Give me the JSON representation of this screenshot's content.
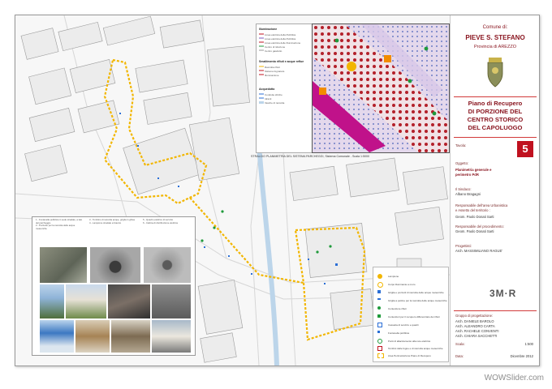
{
  "title_block": {
    "comune_label": "Comune di:",
    "comune_name": "PIEVE S. STEFANO",
    "province": "Provincia di AREZZO",
    "plan_title_lines": [
      "Piano di Recupero",
      "DI PORZIONE DEL",
      "CENTRO STORICO",
      "DEL CAPOLUOGO"
    ],
    "tavola_label": "Tavola:",
    "tavola_number": "5",
    "oggetto_label": "Oggetto:",
    "oggetto_lines": [
      "Planimetria generale e",
      "perimetro PdR"
    ],
    "sindaco_label": "Il Sindaco:",
    "sindaco_name": "Albano Bragagni",
    "resp_label_lines": [
      "Responsabile dell'area Urbanistica",
      "e Assetto del territorio :"
    ],
    "resp_name": "Geom. Paolo Donati Sarti",
    "resp_proc_label": "Responsabile del procedimento:",
    "resp_proc_name": "Geom. Paolo Donati Sarti",
    "progettisti_label": "Progettisti:",
    "progettisti_name": "Arch. MASSIMILIANO RAGUE'",
    "logo_text": "3M·R",
    "gruppo_label": "Gruppo di progettazione:",
    "gruppo_names": [
      "Arch. DANIELE BAROLO",
      "Arch. ALEANDRO CARTA",
      "Arch. RACHELE CONVENTI",
      "Arch. CHIARA SACCHETTI"
    ],
    "scala_label": "Scala:",
    "scala_value": "1:500",
    "data_label": "Data:",
    "data_value": "Dicembre 2012"
  },
  "map": {
    "inset_caption": "STRALCIO PLANIMETRIA DEL SISTEMA PARCHEGGI, Sistema Comunale - Scala 1:5000",
    "top_legend": {
      "heading_1": "Illuminazione",
      "items_1": [
        "Linea elettrica della Pubblica",
        "Linea elettrica della Pubblica",
        "Linea elettrica delle Illuminazione",
        "Centro di riduzione",
        "Centro gasdotto"
      ],
      "heading_2": "Smaltimento rifiuti e acque reflue",
      "items_2": [
        "Raccolta rifiuti",
        "Sistema fognatura",
        "Illuminazione"
      ],
      "heading_3": "Acquedotto",
      "items_3": [
        "Condotte idriche",
        "Idranti",
        "Vasche di raccolta"
      ]
    },
    "bottom_legend": {
      "items": [
        "Lampione",
        "Corpo illuminante a muro",
        "Griglia e pozzetti di raccolta delle acque meteoriche",
        "Griglia a pettine per la raccolta delle acque meteoriche",
        "Contenitore rifiuti",
        "Contenitori per il recupero differenziato dei rifiuti",
        "Cassetta di servizio e quadri",
        "Fontanella pubblica",
        "Punti di allacciamento alla rete elettrica",
        "Tombini delle fogne e di raccolta acque meteoriche",
        "Area Perimetrazione Piano di Recupero"
      ]
    },
    "photo_notes": [
      "1 - Fontanella pubblica in sede stradale, a lato del parcheggio",
      "2 - Pozzetto per la raccolta delle acque meteoriche",
      "3 - Tombino di raccolta acque, griglia in ghisa",
      "4 - Lampione stradale a braccio",
      "5 - Quadro elettrico di servizio",
      "6 - Cabina di distribuzione elettrica"
    ],
    "colors": {
      "perimeter": "#f2b600",
      "plan_title": "#8a1620",
      "tavola_badge": "#c0111f",
      "legend_lamp": "#f2b600",
      "legend_drain": "#2a6ed6",
      "legend_bin": "#1f9a3b"
    }
  },
  "watermark": "WOWSlider.com"
}
